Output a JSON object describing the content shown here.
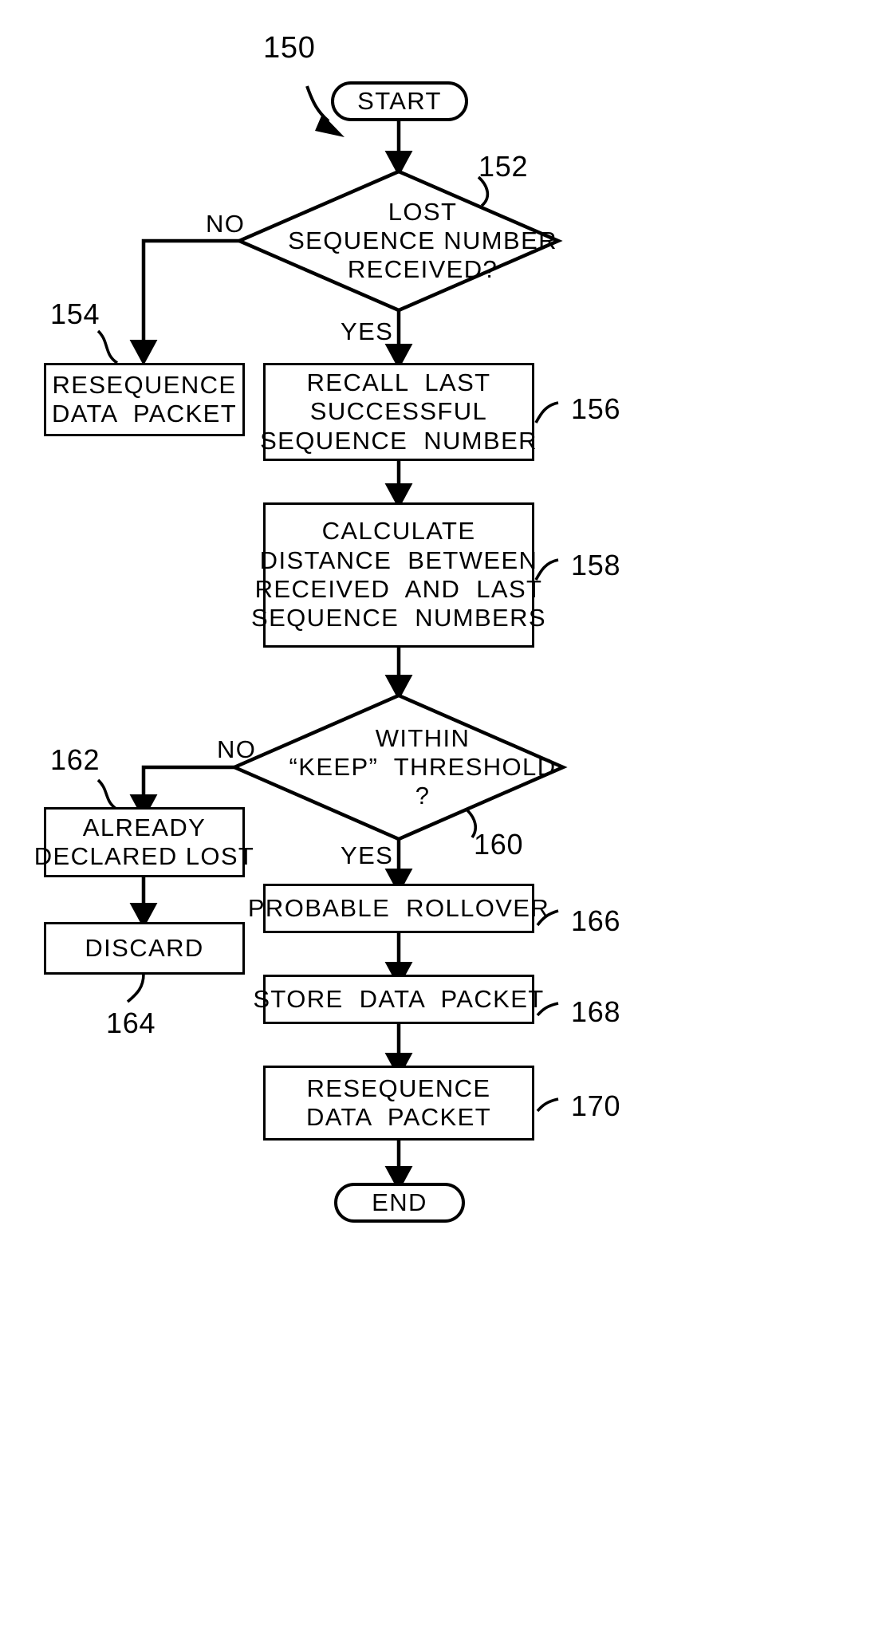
{
  "figure": {
    "number": "150",
    "background_color": "#ffffff",
    "ink_color": "#000000"
  },
  "nodes": {
    "start": {
      "label": "START",
      "shape": "terminator"
    },
    "decision_lost": {
      "ref": "152",
      "shape": "diamond",
      "line1": "LOST",
      "line2": "SEQUENCE NUMBER",
      "line3": "RECEIVED?"
    },
    "resequence_no": {
      "ref": "154",
      "shape": "process",
      "line1": "RESEQUENCE",
      "line2": "DATA  PACKET"
    },
    "recall_last": {
      "ref": "156",
      "shape": "process",
      "line1": "RECALL  LAST",
      "line2": "SUCCESSFUL",
      "line3": "SEQUENCE  NUMBER"
    },
    "calculate_distance": {
      "ref": "158",
      "shape": "process",
      "line1": "CALCULATE",
      "line2": "DISTANCE  BETWEEN",
      "line3": "RECEIVED  AND  LAST",
      "line4": "SEQUENCE  NUMBERS"
    },
    "decision_threshold": {
      "ref": "160",
      "shape": "diamond",
      "line1": "WITHIN",
      "line2": "“KEEP”  THRESHOLD",
      "line3": "?"
    },
    "already_declared_lost": {
      "ref": "162",
      "shape": "process",
      "line1": "ALREADY",
      "line2": "DECLARED LOST"
    },
    "discard": {
      "ref": "164",
      "shape": "process",
      "line1": "DISCARD"
    },
    "probable_rollover": {
      "ref": "166",
      "shape": "process",
      "line1": "PROBABLE  ROLLOVER"
    },
    "store_data_packet": {
      "ref": "168",
      "shape": "process",
      "line1": "STORE  DATA  PACKET"
    },
    "resequence_yes": {
      "ref": "170",
      "shape": "process",
      "line1": "RESEQUENCE",
      "line2": "DATA  PACKET"
    },
    "end": {
      "label": "END",
      "shape": "terminator"
    }
  },
  "edge_labels": {
    "lost_no": "NO",
    "lost_yes": "YES",
    "threshold_no": "NO",
    "threshold_yes": "YES"
  },
  "icons": {
    "flow_arrow": "arrowhead-icon",
    "callout_leader": "leader-line-icon"
  }
}
